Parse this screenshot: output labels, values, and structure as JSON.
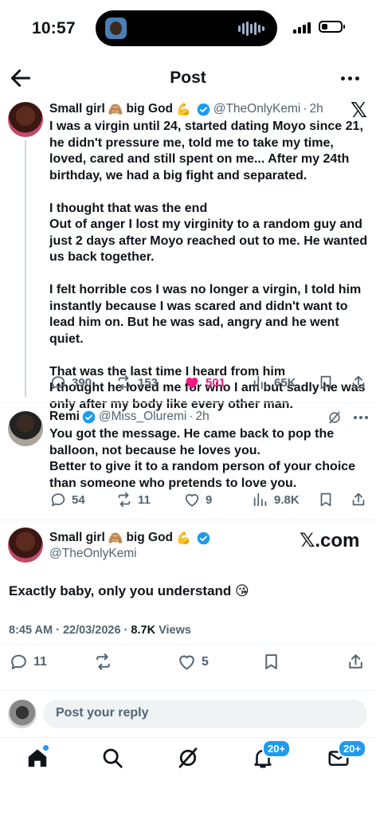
{
  "status_bar": {
    "time": "10:57"
  },
  "header": {
    "title": "Post"
  },
  "tweet1": {
    "name": "Small girl",
    "emoji1": "🙈",
    "name_mid": "big God",
    "emoji2": "💪",
    "handle": "@TheOnlyKemi",
    "age": "2h",
    "platform_mark": "𝕏",
    "text": "I was a virgin until 24, started dating Moyo  since 21, he didn't pressure me, told me to take my time, loved, cared and still spent on me... After my 24th birthday, we had a big fight and separated.\n\nI thought that was the end\nOut of anger I lost my virginity to a random guy and just 2 days after Moyo reached out to me. He wanted us back together.\n\nI felt horrible cos I was no longer a virgin, I told him instantly because I was scared and didn't want to lead him on. But he was sad, angry and he went quiet.\n\nThat was the last time I heard from him\nI thought he loved me for who I am but sadly he was only after my body like every other man.",
    "replies": "390",
    "reposts": "153",
    "likes": "501",
    "views": "65K"
  },
  "tweet2": {
    "name": "Remi",
    "handle": "@Miss_Oluremi",
    "age": "2h",
    "text": "You got the message. He came back to pop the balloon, not because he loves you.\nBetter to give it to a random person of your choice than someone who pretends to love you.",
    "replies": "54",
    "reposts": "11",
    "likes": "9",
    "views": "9.8K"
  },
  "main_post": {
    "name": "Small girl",
    "emoji1": "🙈",
    "name_mid": "big God",
    "emoji2": "💪",
    "handle": "@TheOnlyKemi",
    "brand": "𝕏.com",
    "text": "Exactly baby, only you understand 😘",
    "timestamp": "8:45 AM · 22/03/2026 · ",
    "views_count": "8.7K",
    "views_label": " Views",
    "replies": "11",
    "likes": "5"
  },
  "reply_bar": {
    "placeholder": "Post your reply"
  },
  "tabbar": {
    "notifications_badge": "20+",
    "messages_badge": "20+"
  },
  "colors": {
    "accent": "#1d9bf0",
    "like": "#f91880",
    "muted": "#536471"
  }
}
